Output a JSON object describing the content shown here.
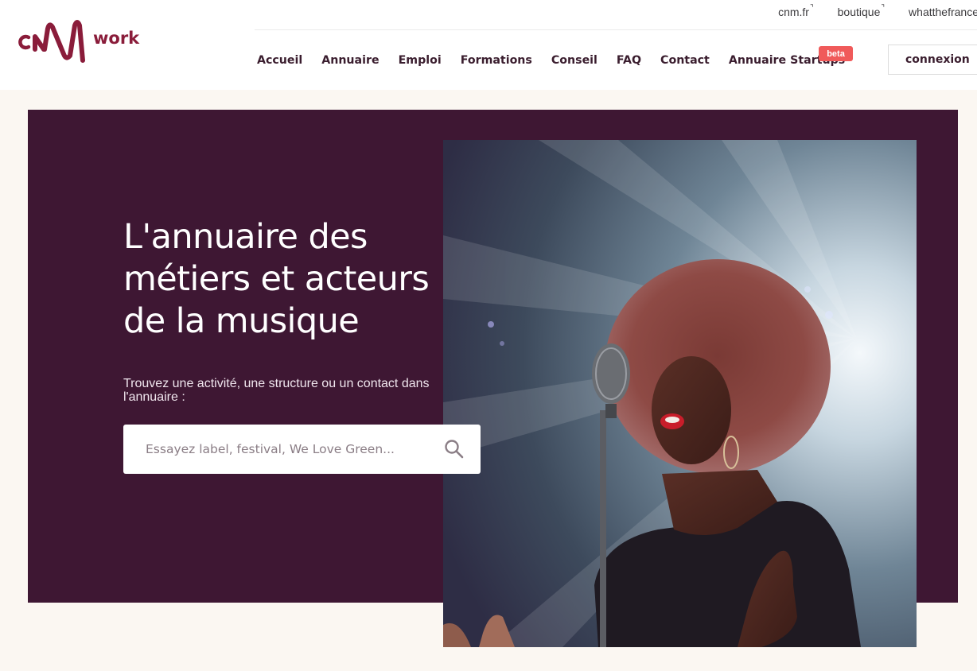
{
  "logo": {
    "brand_name": "cnm",
    "work_label": "work",
    "brand_color": "#8a1c3a"
  },
  "top_links": [
    {
      "label": "cnm.fr"
    },
    {
      "label": "boutique"
    },
    {
      "label": "whatthefrance"
    }
  ],
  "nav": {
    "items": [
      {
        "label": "Accueil"
      },
      {
        "label": "Annuaire"
      },
      {
        "label": "Emploi"
      },
      {
        "label": "Formations"
      },
      {
        "label": "Conseil"
      },
      {
        "label": "FAQ"
      },
      {
        "label": "Contact"
      },
      {
        "label": "Annuaire Startups"
      }
    ],
    "beta_badge": "beta",
    "login_label": "connexion"
  },
  "hero": {
    "background_color": "#3e1733",
    "title_lines": [
      "L'annuaire des",
      "métiers et acteurs",
      "de la musique"
    ],
    "subtitle": "Trouvez une activité, une structure ou un contact dans l'annuaire :",
    "search": {
      "placeholder": "Essayez label, festival, We Love Green..."
    }
  },
  "colors": {
    "beta": "#f05a5a",
    "nav_text": "#3a1d2e",
    "page_background": "#fbf7f2"
  },
  "icons": {
    "search": "search-icon",
    "external_link": "external-link-icon"
  }
}
